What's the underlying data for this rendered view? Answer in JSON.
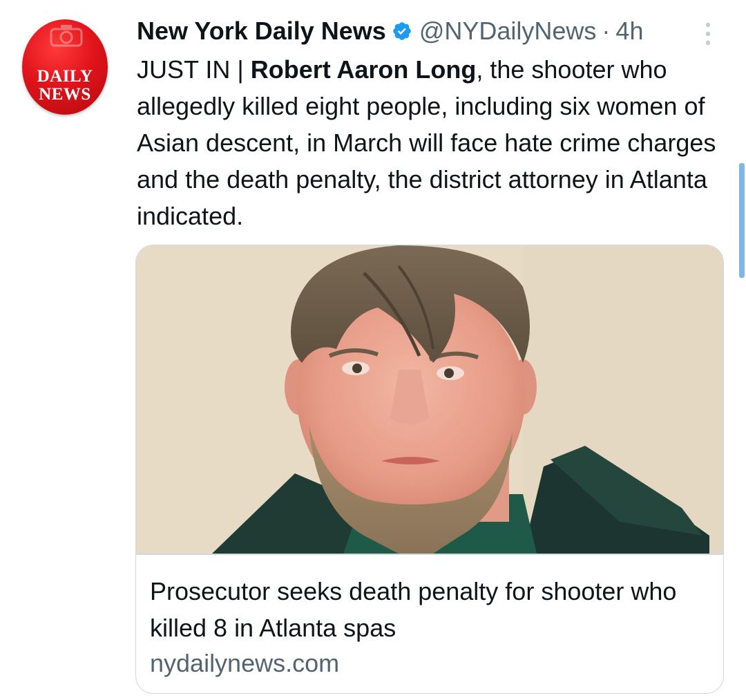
{
  "account": {
    "avatar_logo_line1": "DAILY",
    "avatar_logo_line2": "NEWS",
    "display_name": "New York Daily News",
    "handle": "@NYDailyNews",
    "separator": "·",
    "time": "4h",
    "verified_icon": "verified-badge-icon"
  },
  "tweet": {
    "prefix": "JUST IN | ",
    "bold_name": "Robert Aaron Long",
    "body": ", the shooter who allegedly killed eight people, including six women of Asian descent, in March will face hate crime charges and the death penalty, the district attorney in Atlanta indicated."
  },
  "card": {
    "title": "Prosecutor seeks death penalty for shooter who killed 8 in Atlanta spas",
    "domain": "nydailynews.com"
  },
  "colors": {
    "brand_red": "#e0141b",
    "verified_blue": "#1d9bf0",
    "secondary_text": "#536471",
    "primary_text": "#0f1419",
    "card_border": "#cfd9de"
  }
}
